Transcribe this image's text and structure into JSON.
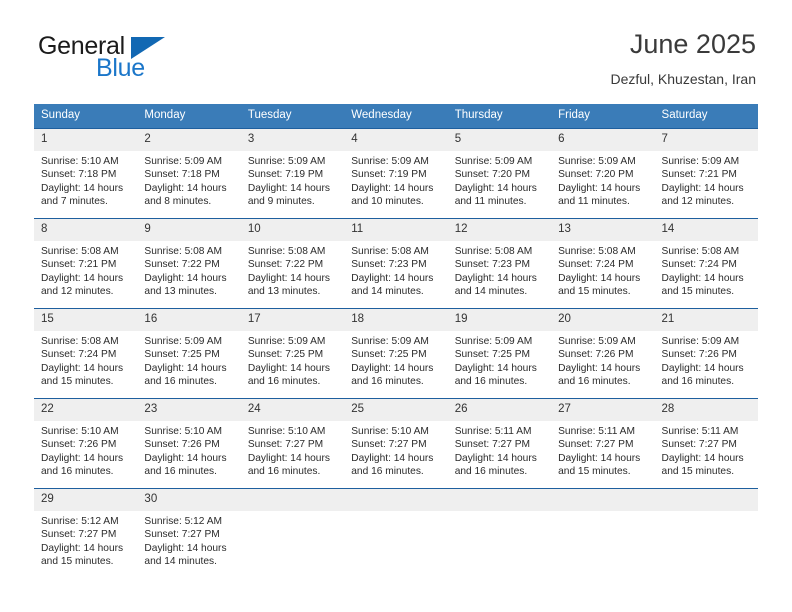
{
  "logo": {
    "word1": "General",
    "word2": "Blue",
    "triangle_color": "#1268b3",
    "word2_color": "#1b76c9"
  },
  "header": {
    "title": "June 2025",
    "subtitle": "Dezful, Khuzestan, Iran"
  },
  "theme": {
    "header_bg": "#3a7cb8",
    "row_border": "#1e5f9e",
    "daynum_bg": "#efefef"
  },
  "weekdays": [
    "Sunday",
    "Monday",
    "Tuesday",
    "Wednesday",
    "Thursday",
    "Friday",
    "Saturday"
  ],
  "weeks": [
    [
      {
        "day": "1",
        "sunrise": "Sunrise: 5:10 AM",
        "sunset": "Sunset: 7:18 PM",
        "daylight": "Daylight: 14 hours and 7 minutes."
      },
      {
        "day": "2",
        "sunrise": "Sunrise: 5:09 AM",
        "sunset": "Sunset: 7:18 PM",
        "daylight": "Daylight: 14 hours and 8 minutes."
      },
      {
        "day": "3",
        "sunrise": "Sunrise: 5:09 AM",
        "sunset": "Sunset: 7:19 PM",
        "daylight": "Daylight: 14 hours and 9 minutes."
      },
      {
        "day": "4",
        "sunrise": "Sunrise: 5:09 AM",
        "sunset": "Sunset: 7:19 PM",
        "daylight": "Daylight: 14 hours and 10 minutes."
      },
      {
        "day": "5",
        "sunrise": "Sunrise: 5:09 AM",
        "sunset": "Sunset: 7:20 PM",
        "daylight": "Daylight: 14 hours and 11 minutes."
      },
      {
        "day": "6",
        "sunrise": "Sunrise: 5:09 AM",
        "sunset": "Sunset: 7:20 PM",
        "daylight": "Daylight: 14 hours and 11 minutes."
      },
      {
        "day": "7",
        "sunrise": "Sunrise: 5:09 AM",
        "sunset": "Sunset: 7:21 PM",
        "daylight": "Daylight: 14 hours and 12 minutes."
      }
    ],
    [
      {
        "day": "8",
        "sunrise": "Sunrise: 5:08 AM",
        "sunset": "Sunset: 7:21 PM",
        "daylight": "Daylight: 14 hours and 12 minutes."
      },
      {
        "day": "9",
        "sunrise": "Sunrise: 5:08 AM",
        "sunset": "Sunset: 7:22 PM",
        "daylight": "Daylight: 14 hours and 13 minutes."
      },
      {
        "day": "10",
        "sunrise": "Sunrise: 5:08 AM",
        "sunset": "Sunset: 7:22 PM",
        "daylight": "Daylight: 14 hours and 13 minutes."
      },
      {
        "day": "11",
        "sunrise": "Sunrise: 5:08 AM",
        "sunset": "Sunset: 7:23 PM",
        "daylight": "Daylight: 14 hours and 14 minutes."
      },
      {
        "day": "12",
        "sunrise": "Sunrise: 5:08 AM",
        "sunset": "Sunset: 7:23 PM",
        "daylight": "Daylight: 14 hours and 14 minutes."
      },
      {
        "day": "13",
        "sunrise": "Sunrise: 5:08 AM",
        "sunset": "Sunset: 7:24 PM",
        "daylight": "Daylight: 14 hours and 15 minutes."
      },
      {
        "day": "14",
        "sunrise": "Sunrise: 5:08 AM",
        "sunset": "Sunset: 7:24 PM",
        "daylight": "Daylight: 14 hours and 15 minutes."
      }
    ],
    [
      {
        "day": "15",
        "sunrise": "Sunrise: 5:08 AM",
        "sunset": "Sunset: 7:24 PM",
        "daylight": "Daylight: 14 hours and 15 minutes."
      },
      {
        "day": "16",
        "sunrise": "Sunrise: 5:09 AM",
        "sunset": "Sunset: 7:25 PM",
        "daylight": "Daylight: 14 hours and 16 minutes."
      },
      {
        "day": "17",
        "sunrise": "Sunrise: 5:09 AM",
        "sunset": "Sunset: 7:25 PM",
        "daylight": "Daylight: 14 hours and 16 minutes."
      },
      {
        "day": "18",
        "sunrise": "Sunrise: 5:09 AM",
        "sunset": "Sunset: 7:25 PM",
        "daylight": "Daylight: 14 hours and 16 minutes."
      },
      {
        "day": "19",
        "sunrise": "Sunrise: 5:09 AM",
        "sunset": "Sunset: 7:25 PM",
        "daylight": "Daylight: 14 hours and 16 minutes."
      },
      {
        "day": "20",
        "sunrise": "Sunrise: 5:09 AM",
        "sunset": "Sunset: 7:26 PM",
        "daylight": "Daylight: 14 hours and 16 minutes."
      },
      {
        "day": "21",
        "sunrise": "Sunrise: 5:09 AM",
        "sunset": "Sunset: 7:26 PM",
        "daylight": "Daylight: 14 hours and 16 minutes."
      }
    ],
    [
      {
        "day": "22",
        "sunrise": "Sunrise: 5:10 AM",
        "sunset": "Sunset: 7:26 PM",
        "daylight": "Daylight: 14 hours and 16 minutes."
      },
      {
        "day": "23",
        "sunrise": "Sunrise: 5:10 AM",
        "sunset": "Sunset: 7:26 PM",
        "daylight": "Daylight: 14 hours and 16 minutes."
      },
      {
        "day": "24",
        "sunrise": "Sunrise: 5:10 AM",
        "sunset": "Sunset: 7:27 PM",
        "daylight": "Daylight: 14 hours and 16 minutes."
      },
      {
        "day": "25",
        "sunrise": "Sunrise: 5:10 AM",
        "sunset": "Sunset: 7:27 PM",
        "daylight": "Daylight: 14 hours and 16 minutes."
      },
      {
        "day": "26",
        "sunrise": "Sunrise: 5:11 AM",
        "sunset": "Sunset: 7:27 PM",
        "daylight": "Daylight: 14 hours and 16 minutes."
      },
      {
        "day": "27",
        "sunrise": "Sunrise: 5:11 AM",
        "sunset": "Sunset: 7:27 PM",
        "daylight": "Daylight: 14 hours and 15 minutes."
      },
      {
        "day": "28",
        "sunrise": "Sunrise: 5:11 AM",
        "sunset": "Sunset: 7:27 PM",
        "daylight": "Daylight: 14 hours and 15 minutes."
      }
    ],
    [
      {
        "day": "29",
        "sunrise": "Sunrise: 5:12 AM",
        "sunset": "Sunset: 7:27 PM",
        "daylight": "Daylight: 14 hours and 15 minutes."
      },
      {
        "day": "30",
        "sunrise": "Sunrise: 5:12 AM",
        "sunset": "Sunset: 7:27 PM",
        "daylight": "Daylight: 14 hours and 14 minutes."
      },
      {
        "day": "",
        "sunrise": "",
        "sunset": "",
        "daylight": ""
      },
      {
        "day": "",
        "sunrise": "",
        "sunset": "",
        "daylight": ""
      },
      {
        "day": "",
        "sunrise": "",
        "sunset": "",
        "daylight": ""
      },
      {
        "day": "",
        "sunrise": "",
        "sunset": "",
        "daylight": ""
      },
      {
        "day": "",
        "sunrise": "",
        "sunset": "",
        "daylight": ""
      }
    ]
  ]
}
